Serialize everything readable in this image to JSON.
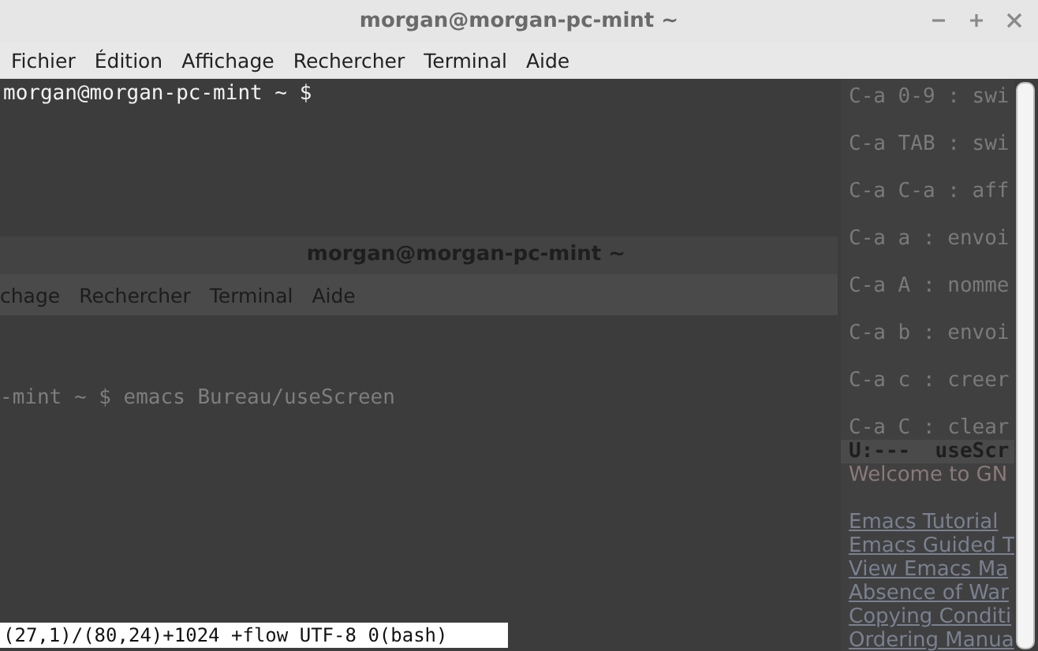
{
  "window": {
    "title": "morgan@morgan-pc-mint ~"
  },
  "menu": [
    "Fichier",
    "Édition",
    "Affichage",
    "Rechercher",
    "Terminal",
    "Aide"
  ],
  "terminal": {
    "lines": [
      "morgan@morgan-pc-mint ~ $"
    ],
    "status_line": "(27,1)/(80,24)+1024 +flow UTF-8 0(bash)"
  },
  "ghost_window": {
    "title": "morgan@morgan-pc-mint ~",
    "menu": [
      "chage",
      "Rechercher",
      "Terminal",
      "Aide"
    ],
    "command_line": "-mint ~ $ emacs Bureau/useScreen"
  },
  "ghost_panel": [
    {
      "kind": "key",
      "text": "C-a 0-9 : swi"
    },
    {
      "kind": "key",
      "text": "C-a TAB : swi"
    },
    {
      "kind": "key",
      "text": "C-a C-a : aff"
    },
    {
      "kind": "key",
      "text": "C-a a : envoi"
    },
    {
      "kind": "key",
      "text": "C-a A : nomme"
    },
    {
      "kind": "key",
      "text": "C-a b : envoi"
    },
    {
      "kind": "key",
      "text": "C-a c : creer"
    },
    {
      "kind": "key",
      "text": "C-a C : clear"
    },
    {
      "kind": "mode",
      "text": "U:---  useScr"
    },
    {
      "kind": "text",
      "text": "Welcome to GN"
    },
    {
      "kind": "link",
      "text": "Emacs Tutorial"
    },
    {
      "kind": "link",
      "text": "Emacs Guided T"
    },
    {
      "kind": "link",
      "text": "View Emacs Ma"
    },
    {
      "kind": "link",
      "text": "Absence of War"
    },
    {
      "kind": "link",
      "text": "Copying Conditi"
    },
    {
      "kind": "link",
      "text": "Ordering Manua"
    }
  ]
}
